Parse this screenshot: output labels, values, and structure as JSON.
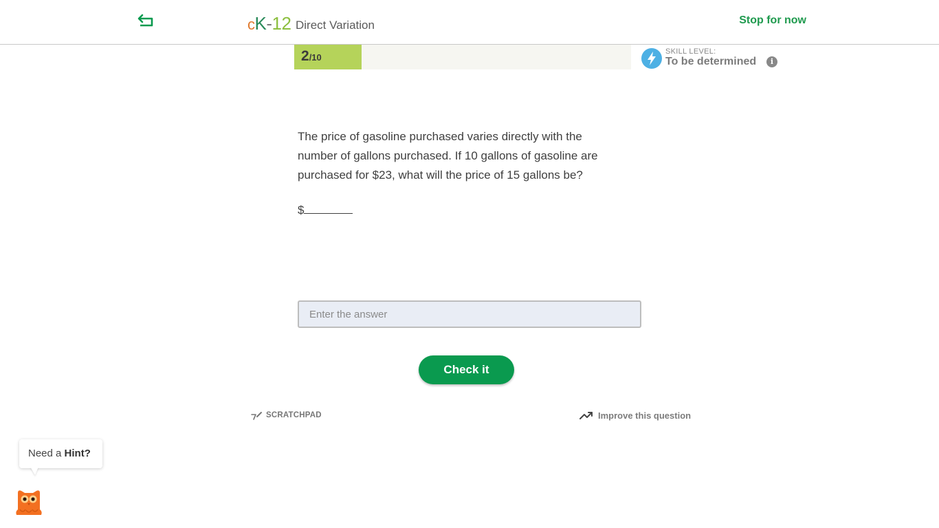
{
  "header": {
    "logo": {
      "c": "c",
      "k": "K",
      "dash": "-",
      "num": "12"
    },
    "title": "Direct Variation",
    "stop_label": "Stop for now",
    "back_icon": "return-arrow-icon"
  },
  "progress": {
    "current": "2",
    "total_label": "/10",
    "fraction": 0.2,
    "fill_color": "#b5d35a"
  },
  "skill": {
    "caption": "SKILL LEVEL:",
    "value": "To be determined",
    "icon": "lightning-icon",
    "info_glyph": "i"
  },
  "question": {
    "text": "The price of gasoline purchased varies directly with the number of gallons purchased. If 10 gallons of gasoline are purchased for $23, what will the price of 15 gallons be?",
    "answer_prefix": "$"
  },
  "answer": {
    "placeholder": "Enter the answer",
    "value": ""
  },
  "check_label": "Check it",
  "footer": {
    "scratchpad_label": "SCRATCHPAD",
    "improve_label": "Improve this question"
  },
  "hint": {
    "prefix": "Need a ",
    "bold": "Hint?"
  },
  "colors": {
    "accent_green": "#0a9a4f",
    "stop_green": "#1f9a4e",
    "skill_blue": "#4db0e4",
    "mascot_orange": "#f37021"
  }
}
